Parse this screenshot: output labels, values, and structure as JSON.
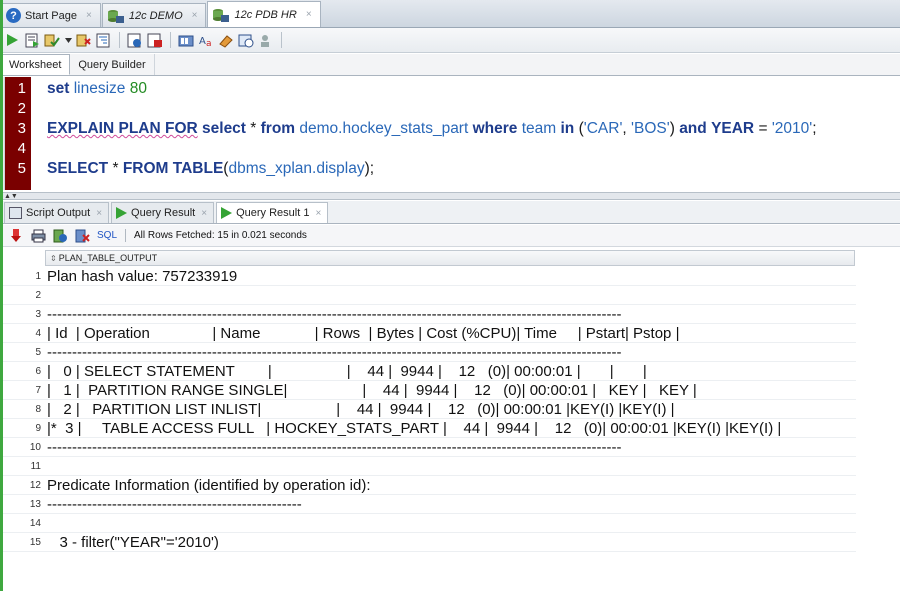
{
  "doc_tabs": [
    {
      "label": "Start Page",
      "active": false
    },
    {
      "label": "12c DEMO",
      "active": false
    },
    {
      "label": "12c PDB HR",
      "active": true
    }
  ],
  "doc_tab_close": "×",
  "worksheet_tabs": [
    "Worksheet",
    "Query Builder"
  ],
  "editor": {
    "line_numbers": [
      "1",
      "2",
      "3",
      "4",
      "5"
    ],
    "line1": {
      "kw": "set",
      "id": "linesize",
      "num": "80"
    },
    "line3": {
      "kw1": "EXPLAIN PLAN FOR",
      "kw2": "select",
      "star": "*",
      "kw3": "from",
      "table": "demo.hockey_stats_part",
      "kw4": "where",
      "col1": "team",
      "kw5": "in",
      "open": "(",
      "s1": "'CAR'",
      "comma": ",",
      "s2": "'BOS'",
      "close": ")",
      "kw6": "and",
      "kw7": "YEAR",
      "eq": "=",
      "s3": "'2010'",
      "semi": ";"
    },
    "line5": {
      "kw1": "SELECT",
      "star": "*",
      "kw2": "FROM",
      "kw3": "TABLE",
      "open": "(",
      "fn": "dbms_xplan.display",
      "close": ");"
    }
  },
  "result_tabs": [
    {
      "label": "Script Output",
      "icon": "script-icon"
    },
    {
      "label": "Query Result",
      "icon": "play-icon"
    },
    {
      "label": "Query Result 1",
      "icon": "play-icon",
      "active": true
    }
  ],
  "results_toolbar": {
    "sql_label": "SQL",
    "fetch_status": "All Rows Fetched: 15 in 0.021 seconds"
  },
  "grid": {
    "column_header": "PLAN_TABLE_OUTPUT",
    "rows": [
      {
        "n": "1",
        "text": "Plan hash value: 757233919"
      },
      {
        "n": "2",
        "text": ""
      },
      {
        "n": "3",
        "text": "-------------------------------------------------------------------------------------------------------------------"
      },
      {
        "n": "4",
        "text": "| Id  | Operation               | Name             | Rows  | Bytes | Cost (%CPU)| Time     | Pstart| Pstop |"
      },
      {
        "n": "5",
        "text": "-------------------------------------------------------------------------------------------------------------------"
      },
      {
        "n": "6",
        "text": "|   0 | SELECT STATEMENT        |                  |    44 |  9944 |    12   (0)| 00:00:01 |       |       |"
      },
      {
        "n": "7",
        "text": "|   1 |  PARTITION RANGE SINGLE|                  |    44 |  9944 |    12   (0)| 00:00:01 |   KEY |   KEY |"
      },
      {
        "n": "8",
        "text": "|   2 |   PARTITION LIST INLIST|                  |    44 |  9944 |    12   (0)| 00:00:01 |KEY(I) |KEY(I) |"
      },
      {
        "n": "9",
        "text": "|*  3 |     TABLE ACCESS FULL   | HOCKEY_STATS_PART |    44 |  9944 |    12   (0)| 00:00:01 |KEY(I) |KEY(I) |"
      },
      {
        "n": "10",
        "text": "-------------------------------------------------------------------------------------------------------------------"
      },
      {
        "n": "11",
        "text": ""
      },
      {
        "n": "12",
        "text": "Predicate Information (identified by operation id):"
      },
      {
        "n": "13",
        "text": "---------------------------------------------------"
      },
      {
        "n": "14",
        "text": ""
      },
      {
        "n": "15",
        "text": "   3 - filter(\"YEAR\"='2010')"
      }
    ]
  },
  "colors": {
    "gutter": "#7a0000",
    "keyword": "#1e3c8c",
    "identifier": "#2a68b8",
    "number": "#238b23",
    "run_green": "#35a335"
  }
}
